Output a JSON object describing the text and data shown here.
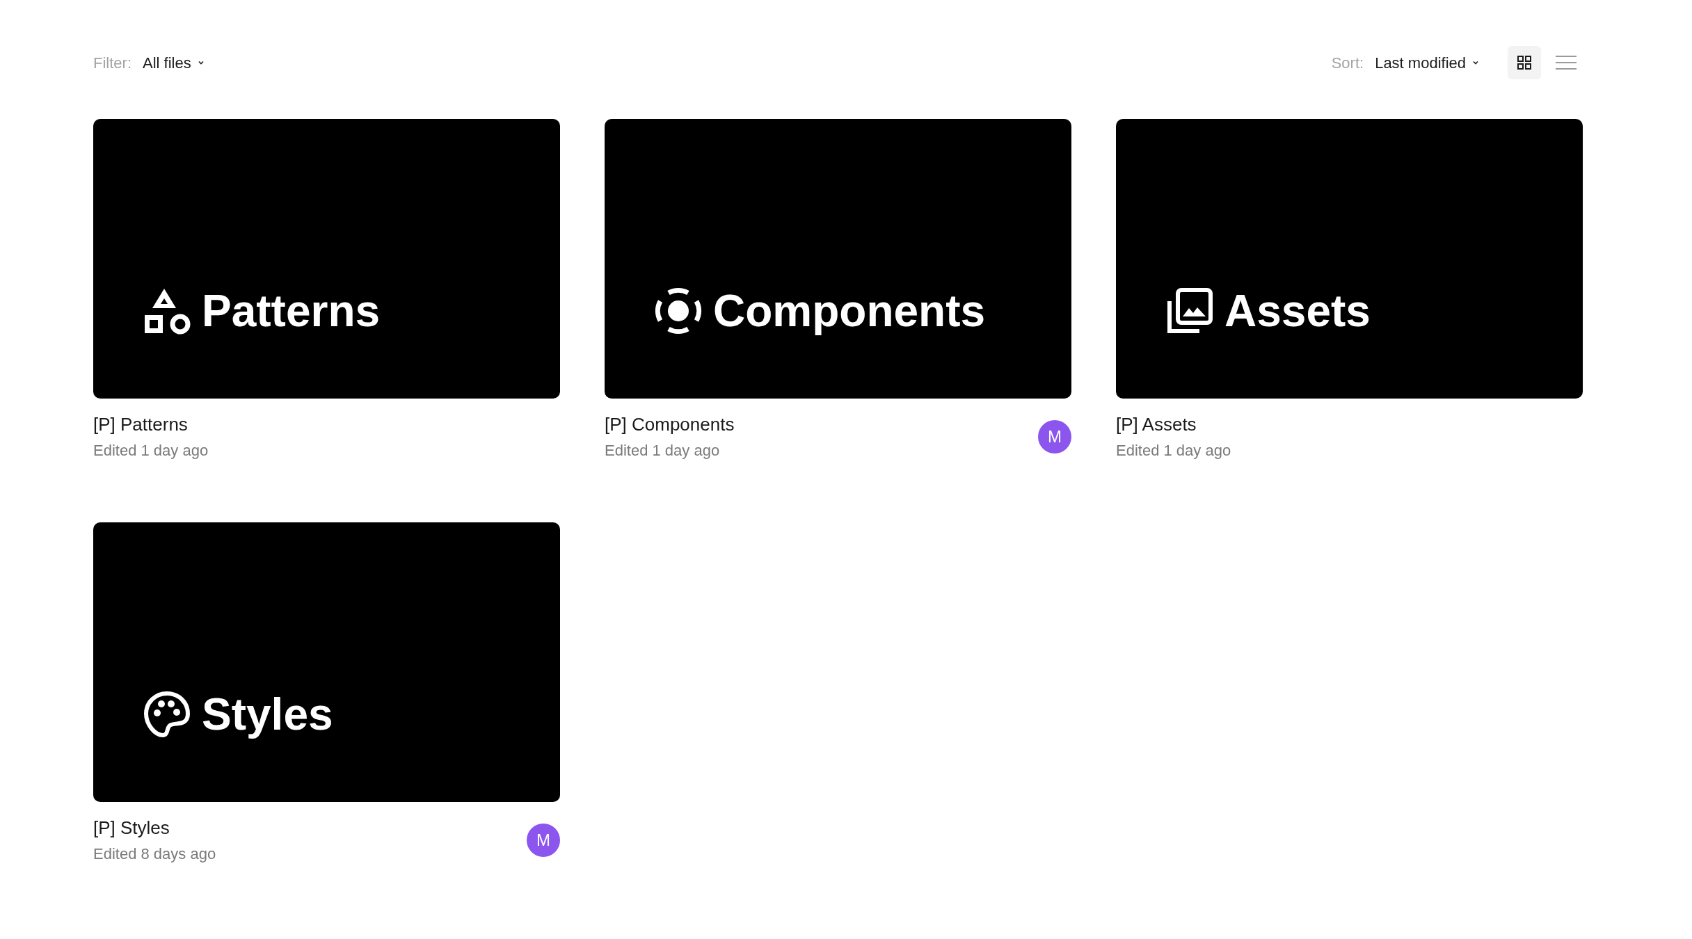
{
  "filter": {
    "label": "Filter:",
    "value": "All files"
  },
  "sort": {
    "label": "Sort:",
    "value": "Last modified"
  },
  "view_toggle": [
    {
      "kind": "grid",
      "selected": true
    },
    {
      "kind": "list",
      "selected": false
    }
  ],
  "files": [
    {
      "cover_title": "Patterns",
      "kind": "shapes",
      "name": "[P] Patterns",
      "edited": "Edited 1 day ago"
    },
    {
      "cover_title": "Components",
      "kind": "target",
      "name": "[P] Components",
      "edited": "Edited 1 day ago",
      "avatar": "M"
    },
    {
      "cover_title": "Assets",
      "kind": "images",
      "name": "[P] Assets",
      "edited": "Edited 1 day ago"
    },
    {
      "cover_title": "Styles",
      "kind": "palette",
      "name": "[P] Styles",
      "edited": "Edited 8 days ago",
      "avatar": "M"
    }
  ]
}
